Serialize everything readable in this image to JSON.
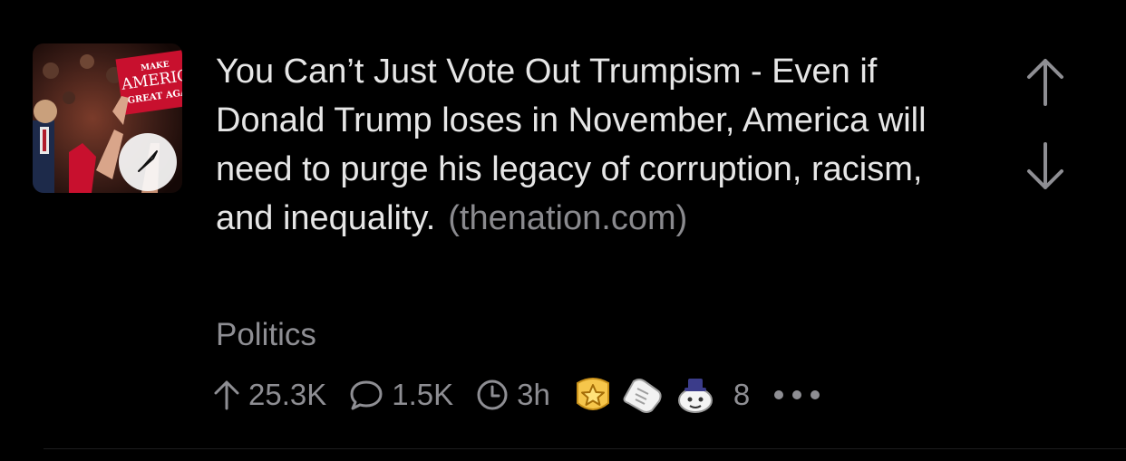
{
  "post": {
    "title": "You Can’t Just Vote Out Trumpism - Even if Donald Trump loses in November, America will need to purge his legacy of corruption, racism, and inequality.",
    "domain": "(thenation.com)",
    "subreddit": "Politics",
    "thumbnail": {
      "sign_line1": "MAKE",
      "sign_line2": "AMERIC",
      "sign_line3": "GREAT AGA"
    },
    "stats": {
      "upvotes": "25.3K",
      "comments": "1.5K",
      "age": "3h",
      "awards_count": "8"
    },
    "icons": [
      "compass-icon",
      "upvote-arrow-icon",
      "downvote-arrow-icon",
      "upvote-small-icon",
      "comment-icon",
      "clock-icon",
      "award-star-icon",
      "award-hand-icon",
      "award-snoo-icon",
      "more-dots-icon"
    ]
  },
  "colors": {
    "background": "#000000",
    "title_text": "#e6e6e6",
    "secondary_text": "#8e8e93",
    "sign_red": "#c8102e"
  }
}
